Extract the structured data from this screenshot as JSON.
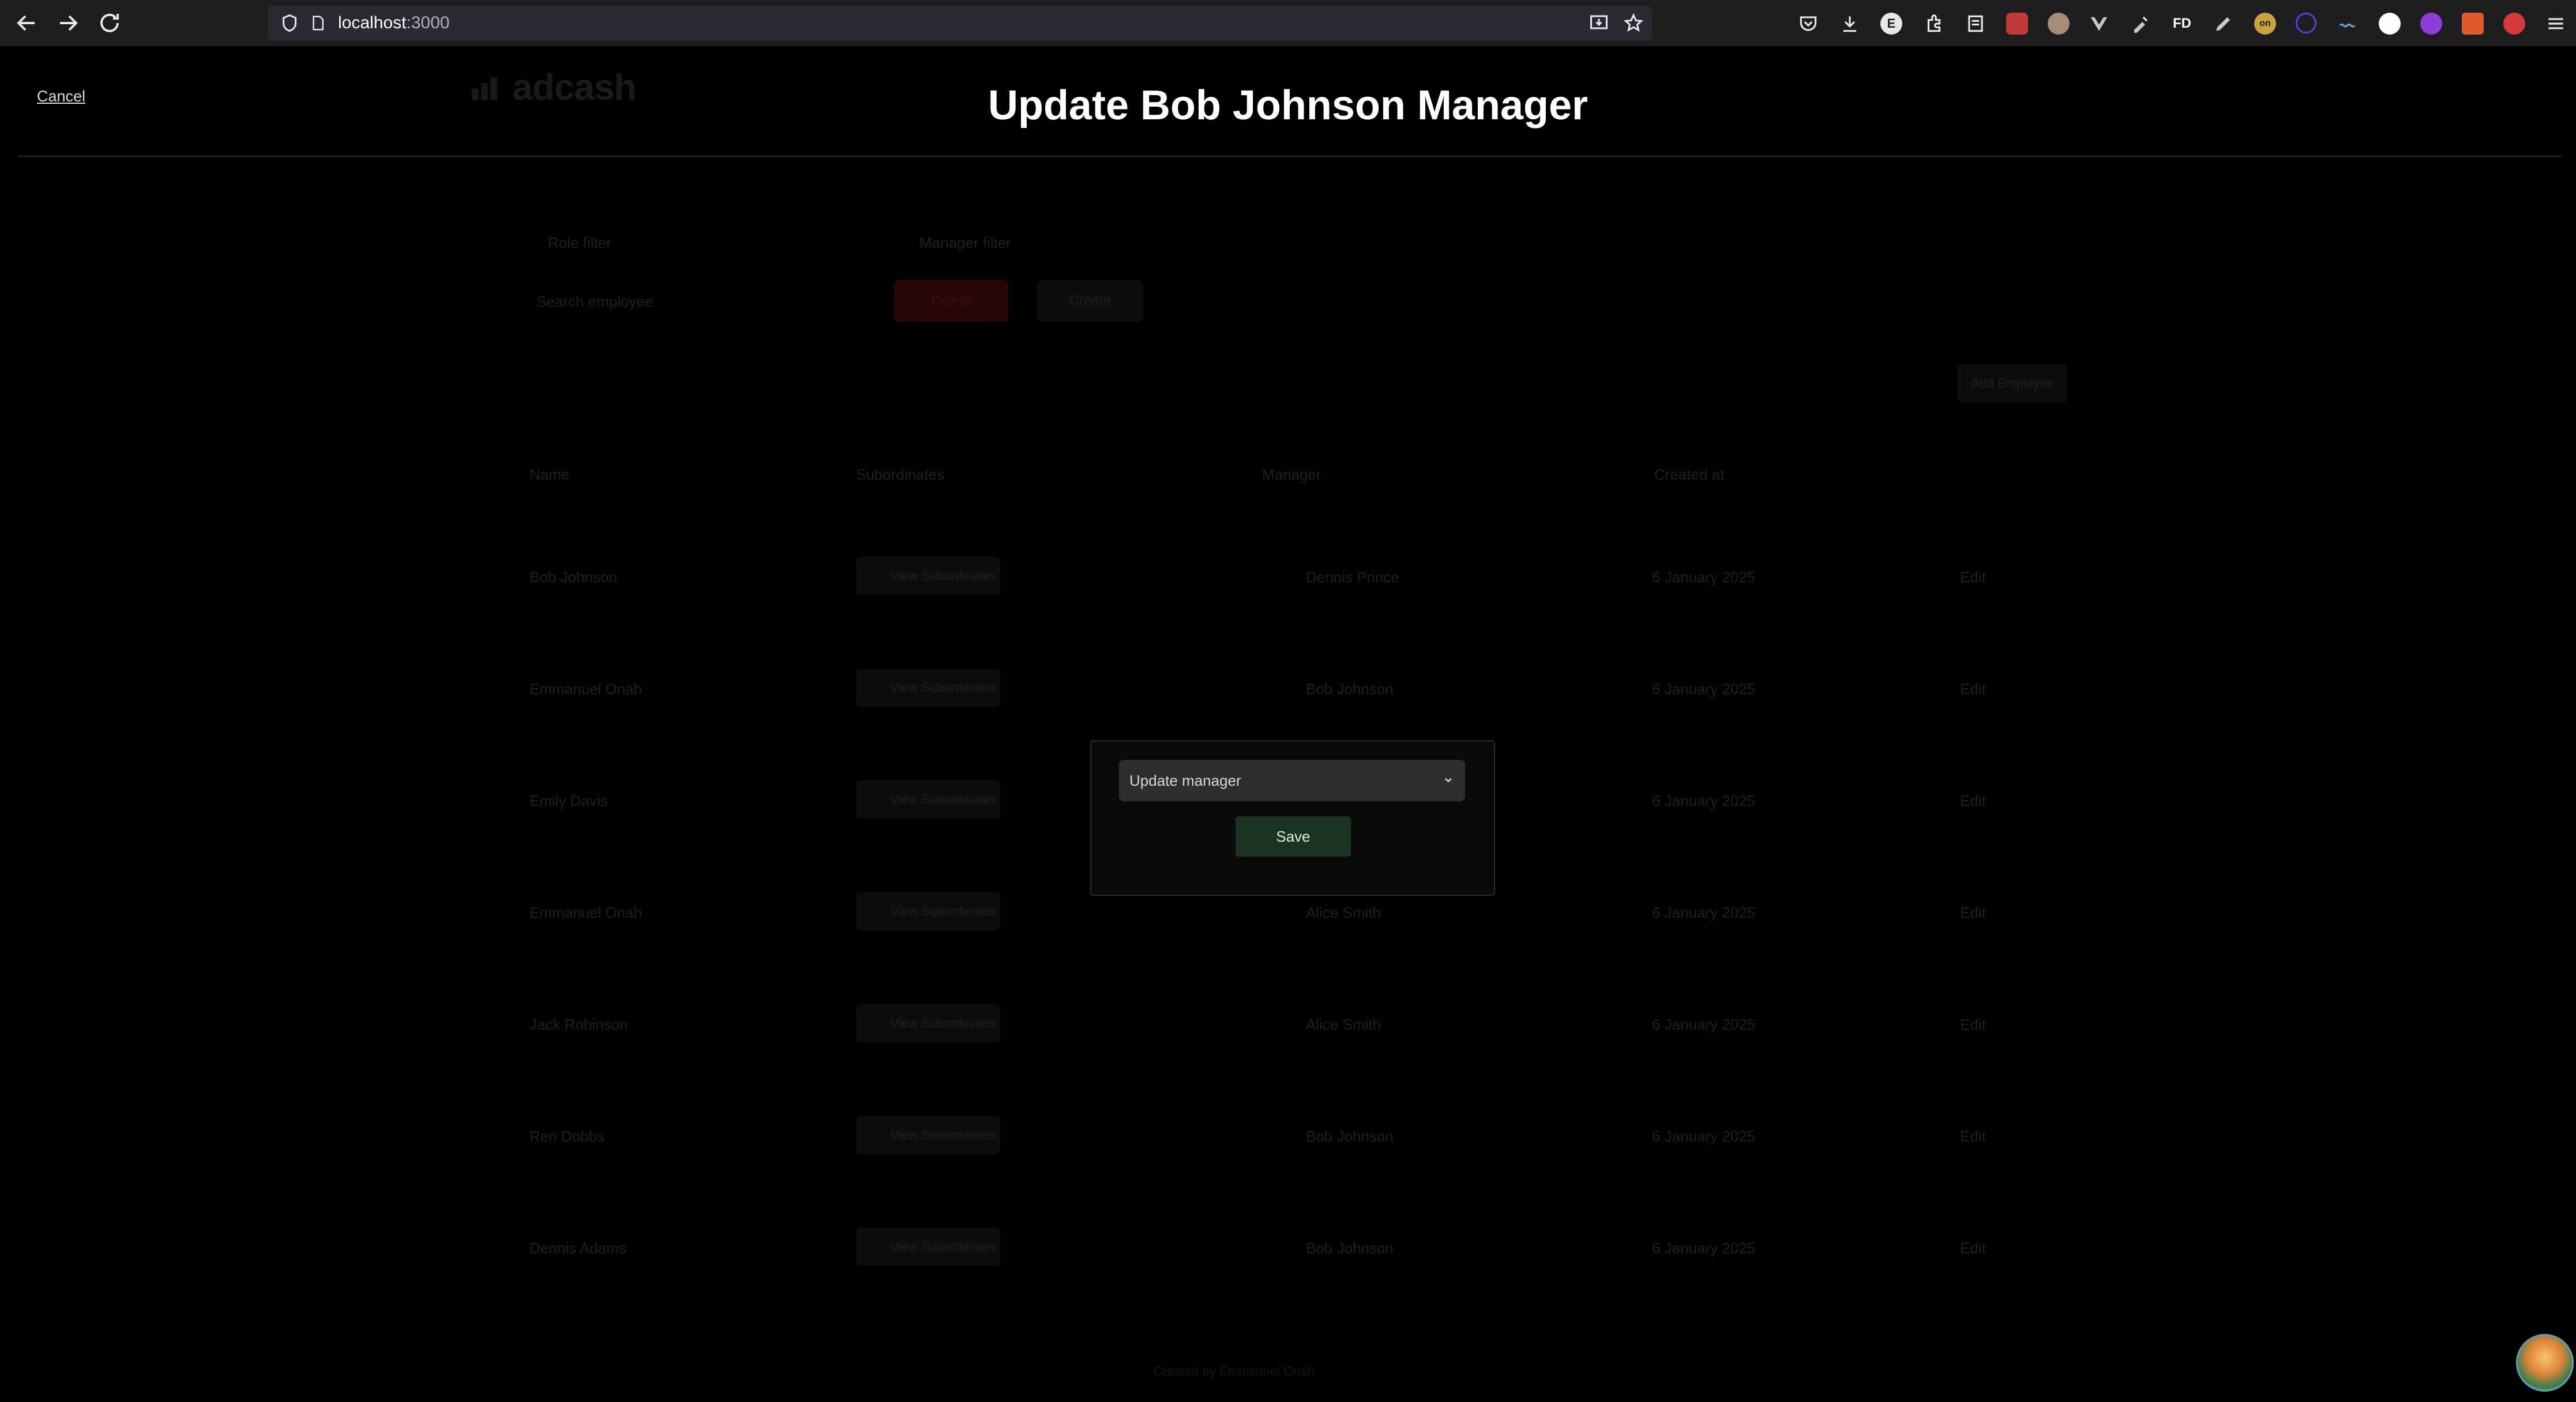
{
  "browser": {
    "url_host": "localhost",
    "url_port": ":3000",
    "ext_fd": "FD",
    "ext_on": "on",
    "ext_e": "E"
  },
  "header": {
    "cancel_label": "Cancel",
    "brand": "adcash",
    "title": "Update Bob Johnson Manager"
  },
  "background": {
    "filters": [
      "Role filter",
      "Manager filter"
    ],
    "search_placeholder": "Search employee",
    "delete_label": "Delete",
    "create_label": "Create",
    "add_employee_label": "Add Employee",
    "columns": [
      "Name",
      "Subordinates",
      "Manager",
      "Created at"
    ],
    "rows": [
      {
        "name": "Bob Johnson",
        "subs": "View Subordinates",
        "manager": "Dennis Prince",
        "created": "6 January 2025",
        "action": "Edit"
      },
      {
        "name": "Emmanuel Onah",
        "subs": "View Subordinates",
        "manager": "Bob Johnson",
        "created": "6 January 2025",
        "action": "Edit"
      },
      {
        "name": "Emily Davis",
        "subs": "View Subordinates",
        "manager": "",
        "created": "6 January 2025",
        "action": "Edit"
      },
      {
        "name": "Emmanuel Onah",
        "subs": "View Subordinates",
        "manager": "Alice Smith",
        "created": "6 January 2025",
        "action": "Edit"
      },
      {
        "name": "Jack Robinson",
        "subs": "View Subordinates",
        "manager": "Alice Smith",
        "created": "6 January 2025",
        "action": "Edit"
      },
      {
        "name": "Ren Dobbs",
        "subs": "View Subordinates",
        "manager": "Bob Johnson",
        "created": "6 January 2025",
        "action": "Edit"
      },
      {
        "name": "Dennis Adams",
        "subs": "View Subordinates",
        "manager": "Bob Johnson",
        "created": "6 January 2025",
        "action": "Edit"
      }
    ],
    "footer": "Created by Emmanuel Onah"
  },
  "modal": {
    "select_value": "Update manager",
    "save_label": "Save"
  },
  "colors": {
    "background": "#000000",
    "modal_bg": "#0a0a0a",
    "save_bg": "#1c3324",
    "delete_bg": "#2a0707"
  }
}
